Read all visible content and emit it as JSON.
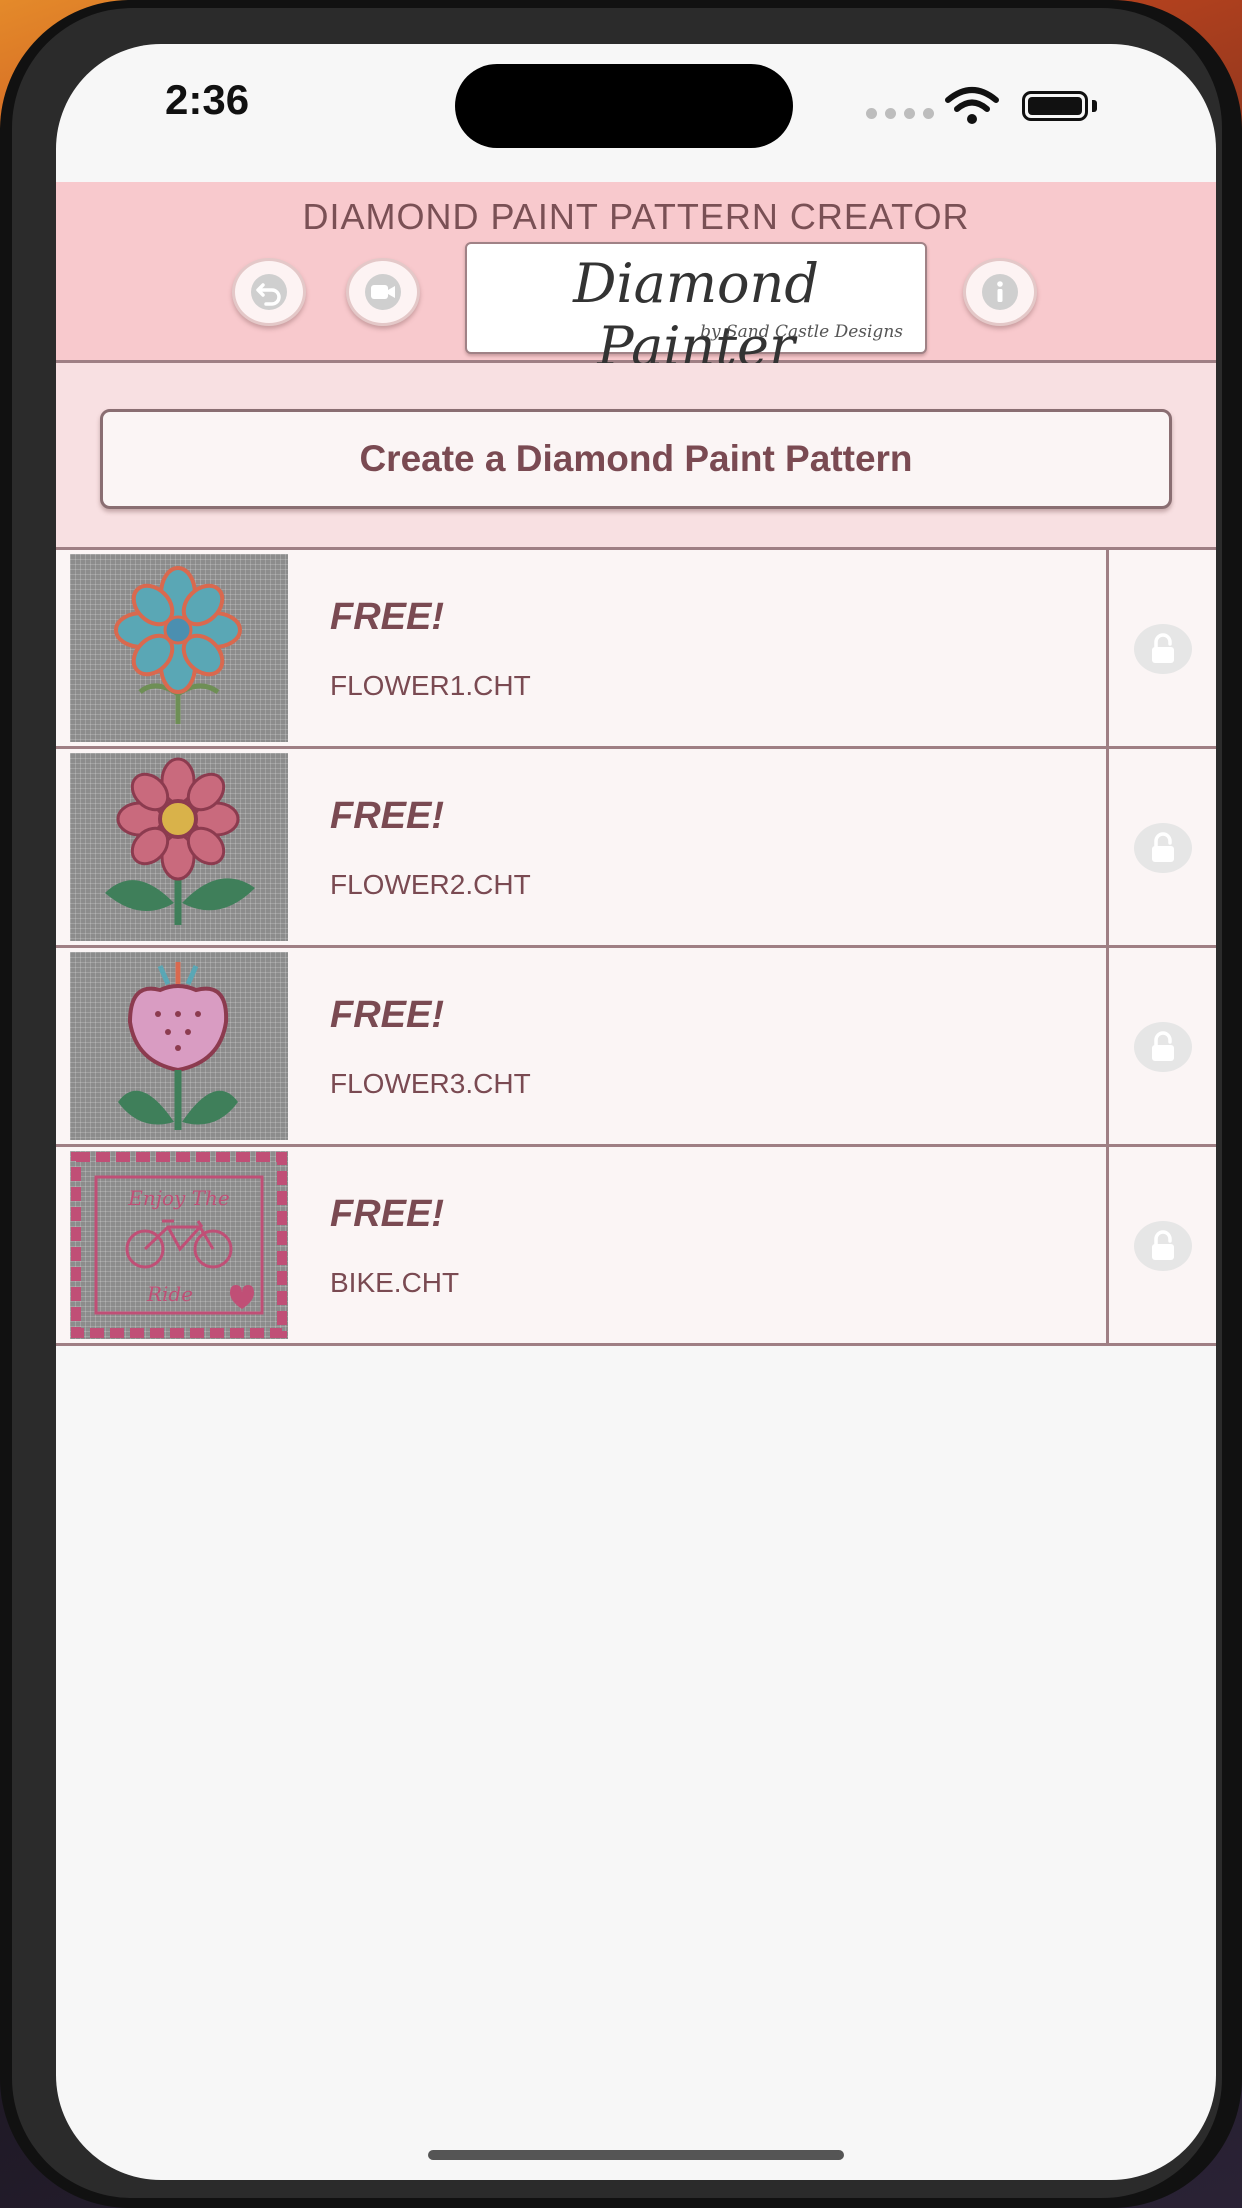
{
  "status_bar": {
    "time": "2:36"
  },
  "header": {
    "title": "DIAMOND PAINT PATTERN CREATOR",
    "logo_text": "Diamond Painter",
    "logo_subtext": "by Sand Castle Designs"
  },
  "actions": {
    "create_label": "Create a Diamond Paint Pattern"
  },
  "patterns": [
    {
      "badge": "FREE!",
      "filename": "FLOWER1.CHT",
      "thumbnail": "flower-blue-icon"
    },
    {
      "badge": "FREE!",
      "filename": "FLOWER2.CHT",
      "thumbnail": "flower-pink-icon"
    },
    {
      "badge": "FREE!",
      "filename": "FLOWER3.CHT",
      "thumbnail": "tulip-icon"
    },
    {
      "badge": "FREE!",
      "filename": "BIKE.CHT",
      "thumbnail": "bike-sampler-icon",
      "thumbnail_text_top": "Enjoy The",
      "thumbnail_text_bottom": "Ride"
    }
  ],
  "colors": {
    "header_bg": "#f8c9cd",
    "section_bg": "#f8e0e2",
    "text_accent": "#7a4a52",
    "row_bg": "#fbf5f5"
  }
}
